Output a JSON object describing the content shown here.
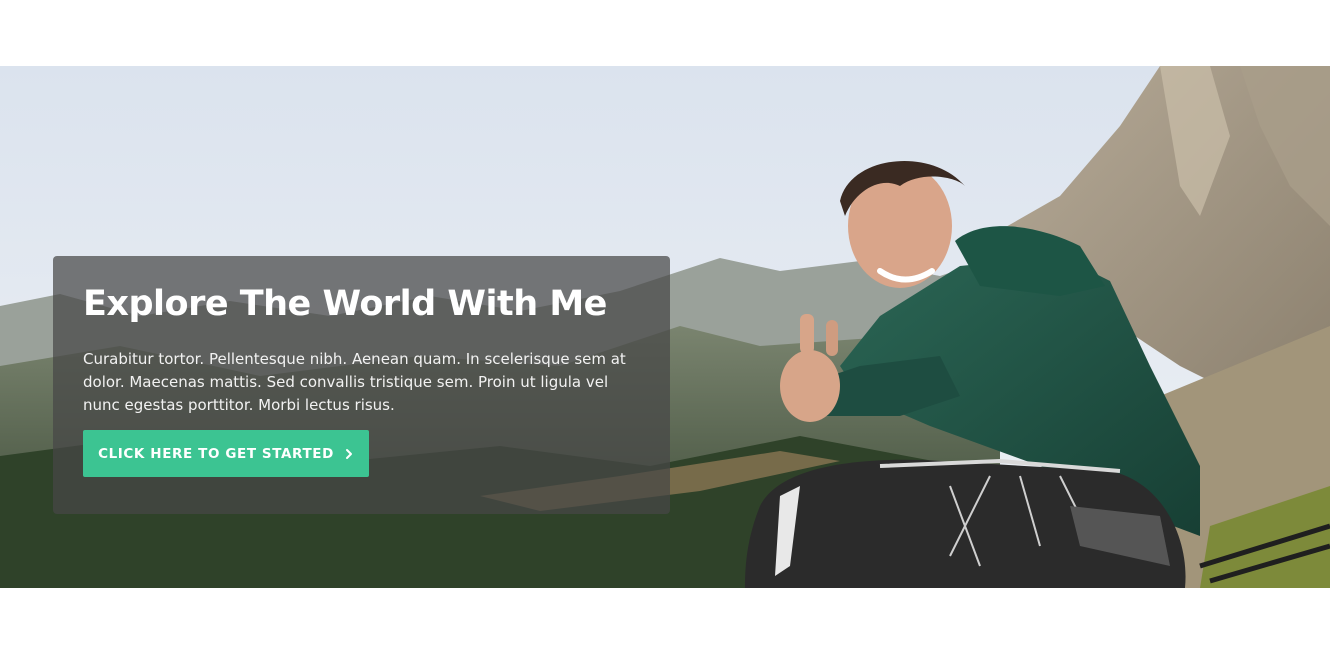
{
  "hero": {
    "title": "Explore The World With Me",
    "description": "Curabitur tortor. Pellentesque nibh. Aenean quam. In scelerisque sem at dolor. Maecenas mattis. Sed convallis tristique sem. Proin ut ligula vel nunc egestas porttitor. Morbi lectus risus.",
    "cta_label": "CLICK HERE TO GET STARTED",
    "cta_icon": "chevron-right-icon",
    "image_subject": "smiling hiker with green jacket and backpack giving thumbs up in the mountains"
  },
  "colors": {
    "accent": "#3cc492",
    "overlay": "rgba(70,70,70,0.72)",
    "text": "#ffffff",
    "page_background": "#ffffff"
  }
}
